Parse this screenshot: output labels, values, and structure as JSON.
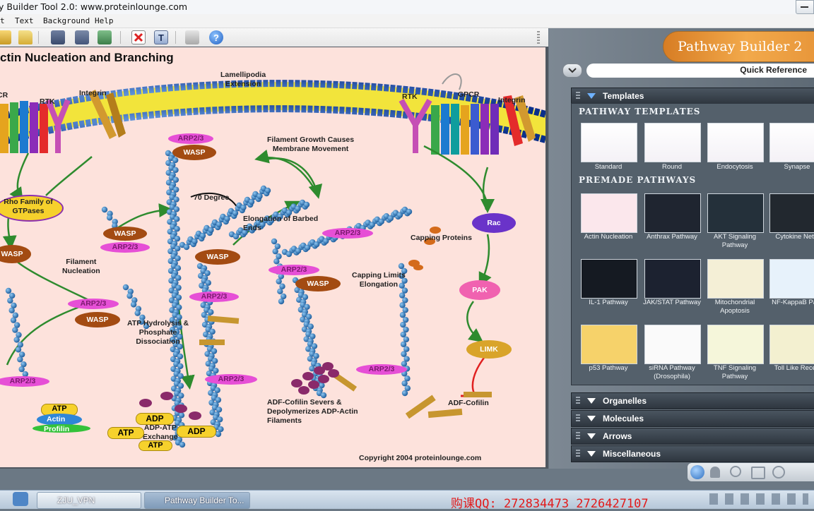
{
  "window": {
    "title": "y Builder Tool 2.0: www.proteinlounge.com"
  },
  "menu": [
    "t",
    "Text",
    "Background",
    "Help"
  ],
  "toolbar": {
    "icons": [
      "open-icon",
      "folder-icon",
      "save-icon",
      "save-as-icon",
      "export-image-icon",
      "delete-icon",
      "text-icon",
      "print-icon",
      "help-icon"
    ]
  },
  "canvas": {
    "title": "ctin Nucleation and Branching",
    "copyright": "Copyright 2004 proteinlounge.com",
    "labels": {
      "gpcr_left": "CR",
      "rtk_left": "RTK",
      "integrin_left": "Integrin",
      "lamellipodia": "Lamellipodia\nExtension",
      "rtk_right": "RTK",
      "gpcr_right": "GPCR",
      "integrin_right": "Integrin",
      "rho": "Rho Family of\nGTPases",
      "filament_growth": "Filament Growth Causes\nMembrane Movement",
      "seventy_degree": "70 Degree",
      "elongation": "Elongation of Barbed\nEnds",
      "filament_nucleation": "Filament\nNucleation",
      "capping_proteins": "Capping Proteins",
      "capping_limits": "Capping Limits\nElongation",
      "atp_hydrolysis": "ATP Hydrolysis &\nPhosphate\nDissociation",
      "adf_severs": "ADF-Cofilin Severs &\nDepolymerizes ADP-Actin\nFilaments",
      "adf_cofilin": "ADF-Cofilin",
      "adp_atp_exchange": "ADP-ATP\nExchange",
      "actin": "Actin",
      "profilin": "Profilin"
    },
    "molecules": {
      "arp": "ARP2/3",
      "wasp": "WASP",
      "rac": "Rac",
      "pak": "PAK",
      "limk": "LIMK",
      "atp": "ATP",
      "adp": "ADP"
    }
  },
  "panel": {
    "logo": "Pathway Builder 2",
    "quick_reference": "Quick Reference",
    "templates_header": "Templates",
    "pathway_templates_title": "PATHWAY TEMPLATES",
    "pathway_templates": [
      "Standard",
      "Round",
      "Endocytosis",
      "Synapse"
    ],
    "premade_title": "PREMADE PATHWAYS",
    "premade": [
      "Actin Nucleation",
      "Anthrax Pathway",
      "AKT Signaling\nPathway",
      "Cytokine Netw",
      "IL-1 Pathway",
      "JAK/STAT Pathway",
      "Mitochondrial\nApoptosis",
      "NF-KappaB Path",
      "p53 Pathway",
      "siRNA Pathway\n(Drosophila)",
      "TNF Signaling\nPathway",
      "Toll  Like Recep"
    ],
    "accordions": [
      "Organelles",
      "Molecules",
      "Arrows",
      "Miscellaneous"
    ]
  },
  "taskbar": {
    "tasks": [
      "ZJU_VPN",
      "Pathway Builder To..."
    ],
    "promo": "购课QQ: 272834473  2726427107"
  },
  "colors": {
    "canvas_bg": "#fde2dc",
    "panel_bg": "#5e6a75",
    "accent_orange": "#e8973b",
    "arrow_green": "#2e8b2e"
  }
}
